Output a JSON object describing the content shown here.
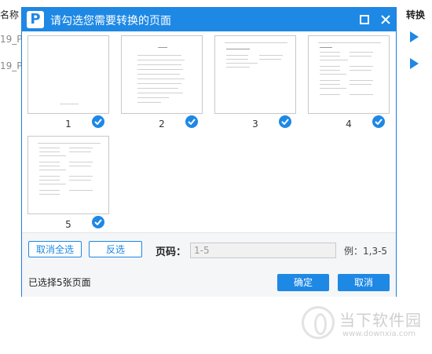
{
  "background": {
    "col_name": "名称",
    "col_convert": "转换",
    "rows": [
      "19_P",
      "19_P"
    ]
  },
  "watermark": {
    "title": "当下软件园",
    "url": "www.downxia.com"
  },
  "dialog": {
    "title": "请勾选您需要转换的页面",
    "app_icon": "P",
    "pages": [
      {
        "number": "1",
        "selected": true
      },
      {
        "number": "2",
        "selected": true
      },
      {
        "number": "3",
        "selected": true
      },
      {
        "number": "4",
        "selected": true
      },
      {
        "number": "5",
        "selected": true
      }
    ],
    "footer": {
      "deselect_all": "取消全选",
      "invert": "反选",
      "page_label": "页码：",
      "page_input_value": "1-5",
      "example": "例：1,3-5",
      "selected_info": "已选择5张页面",
      "ok": "确定",
      "cancel": "取消"
    }
  },
  "colors": {
    "accent": "#1e88e5"
  }
}
